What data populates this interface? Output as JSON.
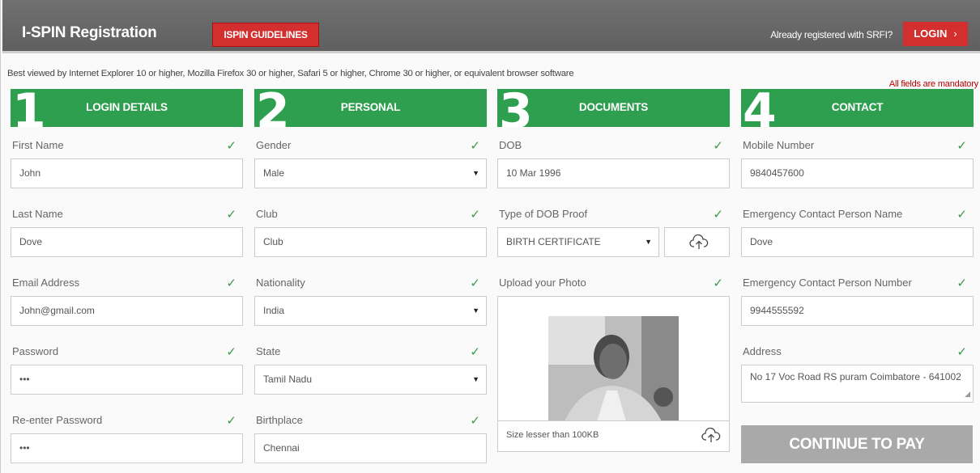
{
  "header": {
    "title": "I-SPIN Registration",
    "guidelines_label": "ISPIN GUIDELINES",
    "already_registered": "Already registered with SRFI?",
    "login_label": "LOGIN",
    "login_chevron": "›"
  },
  "browser_note": "Best viewed by Internet Explorer 10 or higher, Mozilla Firefox 30 or higher, Safari 5 or higher, Chrome 30 or higher, or equivalent browser software",
  "mandatory_note": "All fields are mandatory",
  "check_glyph": "✓",
  "caret_glyph": "▼",
  "columns": [
    {
      "number": "1",
      "title": "LOGIN DETAILS"
    },
    {
      "number": "2",
      "title": "PERSONAL"
    },
    {
      "number": "3",
      "title": "DOCUMENTS"
    },
    {
      "number": "4",
      "title": "CONTACT"
    }
  ],
  "login": {
    "first_name": {
      "label": "First Name",
      "value": "John"
    },
    "last_name": {
      "label": "Last Name",
      "value": "Dove"
    },
    "email": {
      "label": "Email Address",
      "value": "John@gmail.com"
    },
    "password": {
      "label": "Password",
      "value": "•••"
    },
    "reenter_password": {
      "label": "Re-enter Password",
      "value": "•••"
    }
  },
  "personal": {
    "gender": {
      "label": "Gender",
      "value": "Male"
    },
    "club": {
      "label": "Club",
      "value": "Club"
    },
    "nationality": {
      "label": "Nationality",
      "value": "India"
    },
    "state": {
      "label": "State",
      "value": "Tamil Nadu"
    },
    "birthplace": {
      "label": "Birthplace",
      "value": "Chennai"
    }
  },
  "documents": {
    "dob": {
      "label": "DOB",
      "value": "10 Mar 1996"
    },
    "dob_proof": {
      "label": "Type of DOB Proof",
      "value": "BIRTH CERTIFICATE"
    },
    "photo": {
      "label": "Upload your Photo",
      "size_note": "Size lesser than 100KB"
    }
  },
  "contact": {
    "mobile": {
      "label": "Mobile Number",
      "value": "9840457600"
    },
    "emergency_name": {
      "label": "Emergency Contact Person Name",
      "value": "Dove"
    },
    "emergency_number": {
      "label": "Emergency Contact Person Number",
      "value": "9944555592"
    },
    "address": {
      "label": "Address",
      "value": "No 17 Voc Road RS puram Coimbatore - 641002"
    }
  },
  "continue_label": "CONTINUE TO PAY",
  "colors": {
    "accent_green": "#2e9e4f",
    "accent_red": "#d32f2f",
    "header_gray": "#666666"
  }
}
